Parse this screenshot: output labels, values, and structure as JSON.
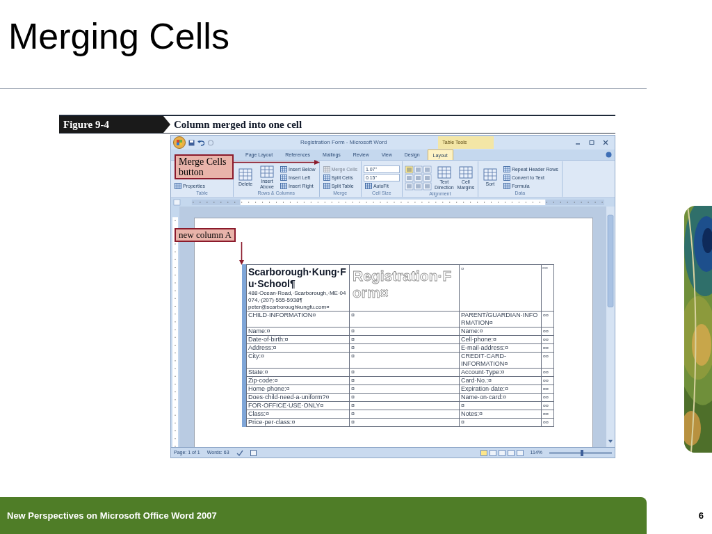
{
  "slide": {
    "title": "Merging Cells",
    "footer": "New Perspectives on Microsoft Office Word 2007",
    "page_number": "6"
  },
  "figure": {
    "label": "Figure 9-4",
    "caption": "Column merged into one cell"
  },
  "window": {
    "title": "Registration Form - Microsoft Word",
    "context_group": "Table Tools"
  },
  "tabs": [
    {
      "label": "Page Layout",
      "selected": false
    },
    {
      "label": "References",
      "selected": false
    },
    {
      "label": "Mailings",
      "selected": false
    },
    {
      "label": "Review",
      "selected": false
    },
    {
      "label": "View",
      "selected": false
    },
    {
      "label": "Design",
      "selected": false
    },
    {
      "label": "Layout",
      "selected": true
    }
  ],
  "ribbon_groups": [
    {
      "label": "Table",
      "commands": [
        {
          "kind": "small",
          "label": "Properties",
          "disabled": false
        }
      ]
    },
    {
      "label": "Rows & Columns",
      "commands": [
        {
          "kind": "large",
          "label": "Delete",
          "disabled": false
        },
        {
          "kind": "large",
          "label": "Insert Above",
          "disabled": false
        },
        {
          "kind": "small",
          "label": "Insert Below",
          "disabled": false
        },
        {
          "kind": "small",
          "label": "Insert Left",
          "disabled": false
        },
        {
          "kind": "small",
          "label": "Insert Right",
          "disabled": false
        }
      ]
    },
    {
      "label": "Merge",
      "commands": [
        {
          "kind": "small",
          "label": "Merge Cells",
          "disabled": true
        },
        {
          "kind": "small",
          "label": "Split Cells",
          "disabled": false
        },
        {
          "kind": "small",
          "label": "Split Table",
          "disabled": false
        }
      ]
    },
    {
      "label": "Cell Size",
      "commands": [
        {
          "kind": "spin",
          "label": "1.07\"",
          "disabled": false
        },
        {
          "kind": "spin",
          "label": "0.15\"",
          "disabled": false
        },
        {
          "kind": "small",
          "label": "AutoFit",
          "disabled": false
        }
      ]
    },
    {
      "label": "Alignment",
      "commands": [
        {
          "kind": "align_grid"
        },
        {
          "kind": "large",
          "label": "Text Direction",
          "disabled": false
        },
        {
          "kind": "large",
          "label": "Cell Margins",
          "disabled": false
        }
      ]
    },
    {
      "label": "Data",
      "commands": [
        {
          "kind": "large",
          "label": "Sort",
          "disabled": false
        },
        {
          "kind": "small",
          "label": "Repeat Header Rows",
          "disabled": false
        },
        {
          "kind": "small",
          "label": "Convert to Text",
          "disabled": false
        },
        {
          "kind": "small",
          "label": "Formula",
          "disabled": false
        }
      ]
    }
  ],
  "callouts": [
    {
      "text": "Merge Cells button"
    },
    {
      "text": "new column A"
    }
  ],
  "document": {
    "merged_column": {
      "selected": true
    },
    "header": {
      "school": "Scarborough·Kung·Fu·School¶",
      "address": "488·Ocean·Road,·Scarborough,·ME·04074,·(207)·555-5938¶",
      "email": "peter@scarboroughkungfu.com¤",
      "form_title": "Registration·Form¤",
      "column_3": "¤",
      "column_4": "¤¤"
    },
    "rows": [
      [
        "CHILD·INFORMATION¤",
        "¤",
        "PARENT/GUARDIAN·INFORMATION¤",
        "¤¤"
      ],
      [
        "Name:¤",
        "¤",
        "Name:¤",
        "¤¤"
      ],
      [
        "Date·of·birth:¤",
        "¤",
        "Cell·phone:¤",
        "¤¤"
      ],
      [
        "Address:¤",
        "¤",
        "E-mail·address:¤",
        "¤¤"
      ],
      [
        "City:¤",
        "¤",
        "CREDIT·CARD-INFORMATION¤",
        "¤¤"
      ],
      [
        "State:¤",
        "¤",
        "Account·Type:¤",
        "¤¤"
      ],
      [
        "Zip·code:¤",
        "¤",
        "Card·No.:¤",
        "¤¤"
      ],
      [
        "Home·phone:¤",
        "¤",
        "Expiration·date:¤",
        "¤¤"
      ],
      [
        "Does·child·need·a·uniform?¤",
        "¤",
        "Name·on·card:¤",
        "¤¤"
      ],
      [
        "FOR·OFFICE·USE·ONLY¤",
        "¤",
        "¤",
        "¤¤"
      ],
      [
        "Class:¤",
        "¤",
        "Notes:¤",
        "¤¤"
      ],
      [
        "Price·per·class:¤",
        "¤",
        "¤",
        "¤¤"
      ]
    ]
  },
  "status_bar": {
    "page": "Page: 1 of 1",
    "words": "Words: 63",
    "zoom": "114%",
    "zoom_slider": {
      "level": 0.5
    }
  }
}
